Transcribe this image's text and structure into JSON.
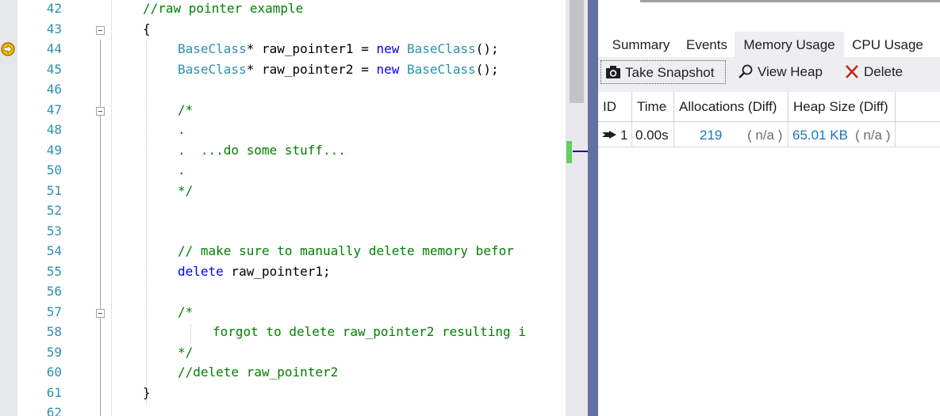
{
  "editor": {
    "line_numbers": [
      "42",
      "43",
      "44",
      "45",
      "46",
      "47",
      "48",
      "49",
      "50",
      "51",
      "52",
      "53",
      "54",
      "55",
      "56",
      "57",
      "58",
      "59",
      "60",
      "61",
      "62"
    ],
    "code": {
      "l42": "//raw pointer example",
      "l43": "{",
      "l44_type": "BaseClass",
      "l44_mid": "* raw_pointer1 = ",
      "l44_kw": "new",
      "l44_type2": "BaseClass",
      "l44_end": "();",
      "l45_type": "BaseClass",
      "l45_mid": "* raw_pointer2 = ",
      "l45_kw": "new",
      "l45_type2": "BaseClass",
      "l45_end": "();",
      "l47": "/*",
      "l48": ".",
      "l49": ".  ...do some stuff...",
      "l50": ".",
      "l51": "*/",
      "l54": "// make sure to manually delete memory befor",
      "l55_kw": "delete",
      "l55_rest": " raw_pointer1;",
      "l57": "/*",
      "l58": "forgot to delete raw_pointer2 resulting i",
      "l59": "*/",
      "l60": "//delete raw_pointer2",
      "l61": "}"
    },
    "breakpoint_icon": "current-statement-arrow-icon",
    "colors": {
      "keyword": "#0000ff",
      "type": "#2b91af",
      "comment": "#008000",
      "line_number": "#2b91af"
    }
  },
  "diagnostics": {
    "tabs": [
      {
        "label": "Summary"
      },
      {
        "label": "Events"
      },
      {
        "label": "Memory Usage",
        "active": true
      },
      {
        "label": "CPU Usage"
      }
    ],
    "toolbar": {
      "take_snapshot": "Take Snapshot",
      "take_snapshot_icon": "camera-icon",
      "view_heap": "View Heap",
      "view_heap_icon": "magnifier-icon",
      "delete": "Delete",
      "delete_icon": "red-x-icon"
    },
    "table": {
      "headers": [
        "ID",
        "Time",
        "Allocations (Diff)",
        "Heap Size (Diff)"
      ],
      "rows": [
        {
          "id": "1",
          "time": "0.00s",
          "allocations": "219",
          "allocations_diff": "( n/a )",
          "heap_size": "65.01 KB",
          "heap_size_diff": "( n/a )"
        }
      ]
    }
  }
}
